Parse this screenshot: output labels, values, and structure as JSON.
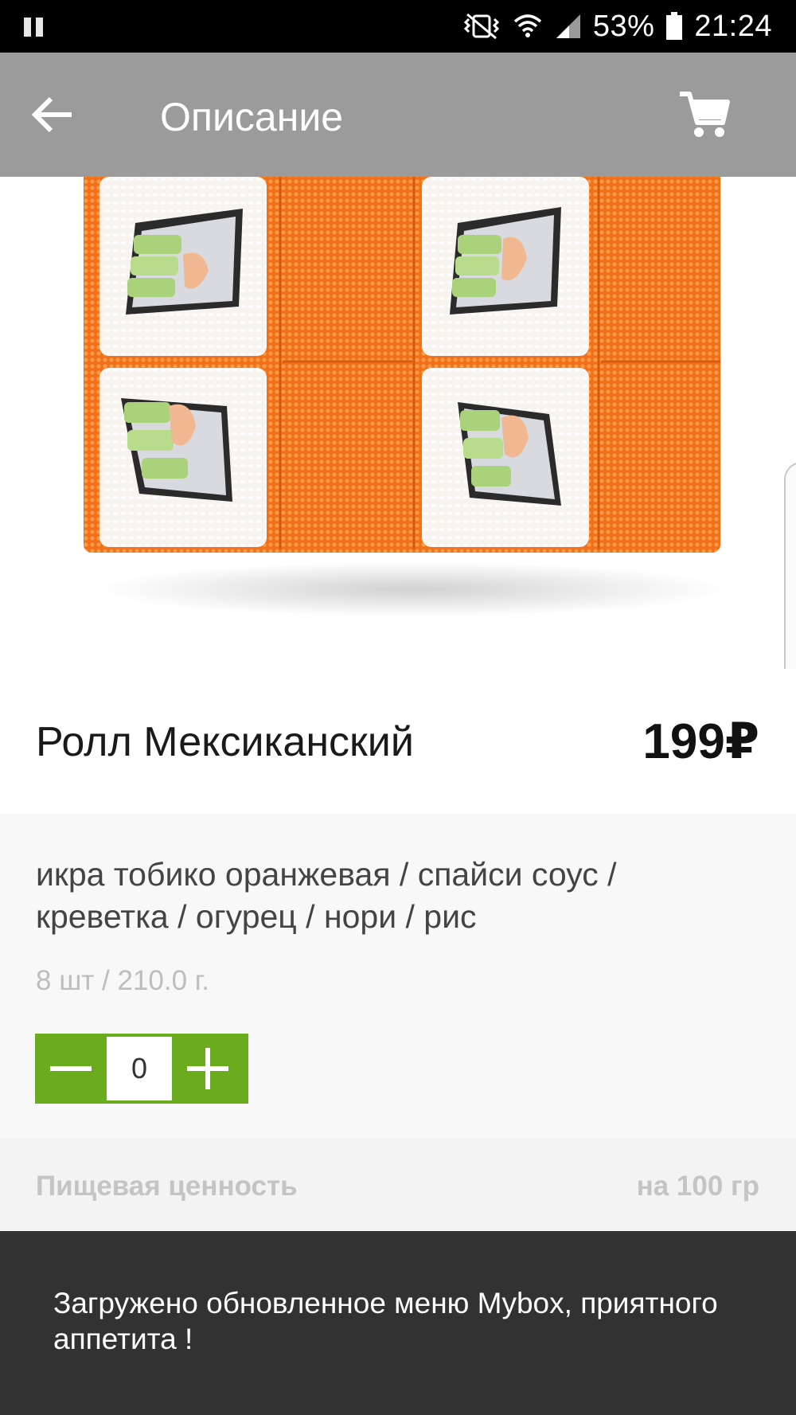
{
  "status_bar": {
    "battery": "53%",
    "time": "21:24",
    "icons": [
      "pause-icon",
      "vibrate-icon",
      "wifi-icon",
      "signal-icon",
      "battery-icon"
    ]
  },
  "app_bar": {
    "title": "Описание",
    "back_icon": "arrow-back-icon",
    "cart_icon": "cart-icon",
    "background": "#9b9b9b"
  },
  "product": {
    "name": "Ролл Мексиканский",
    "price": "199₽",
    "ingredients": "икра тобико оранжевая / спайси соус / креветка / огурец / нори / рис",
    "portion": "8 шт / 210.0 г.",
    "quantity": "0",
    "accent": "#6aac1e"
  },
  "nutrition": {
    "label": "Пищевая ценность",
    "per": "на 100 гр"
  },
  "snackbar": {
    "message": "Загружено обновленное меню Mybox, приятного аппетита !"
  }
}
